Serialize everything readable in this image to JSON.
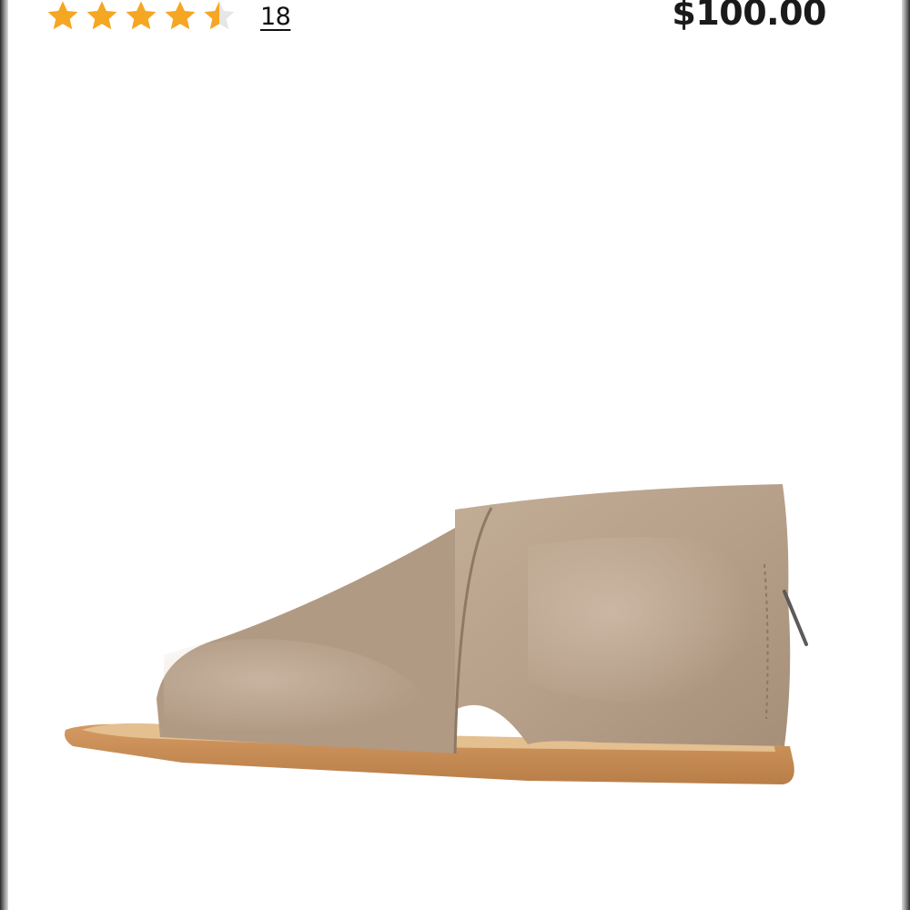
{
  "product": {
    "rating": {
      "value": 4.5,
      "max": 5,
      "review_count": "18",
      "star_color": "#F5A623",
      "empty_star_color": "#E6E6E6"
    },
    "price": "$100.00",
    "image": {
      "icon": "suede-sandal-product-photo",
      "colors": {
        "suede": "#B9A38D",
        "suede_shadow": "#9C8671",
        "sole": "#C98E57",
        "footbed": "#DFB98A"
      }
    }
  }
}
